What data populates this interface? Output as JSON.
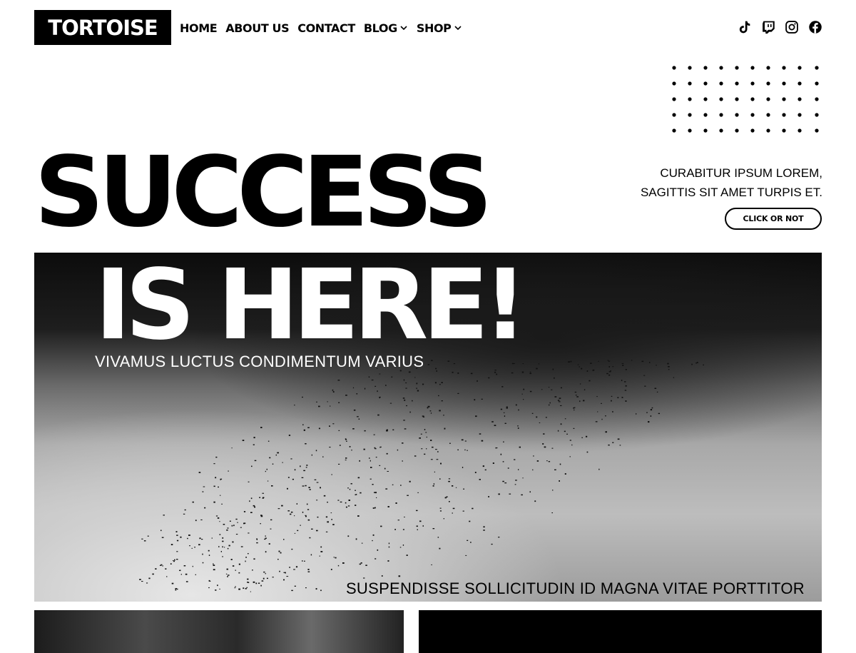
{
  "header": {
    "logo": "TORTOISE",
    "nav": [
      {
        "label": "HOME",
        "has_dropdown": false
      },
      {
        "label": "ABOUT US",
        "has_dropdown": false
      },
      {
        "label": "CONTACT",
        "has_dropdown": false
      },
      {
        "label": "BLOG",
        "has_dropdown": true
      },
      {
        "label": "SHOP",
        "has_dropdown": true
      }
    ],
    "social_icons": [
      "tiktok-icon",
      "twitch-icon",
      "instagram-icon",
      "facebook-icon"
    ]
  },
  "hero": {
    "headline_line1": "SUCCESS",
    "headline_line2": "IS HERE!",
    "subtitle": "VIVAMUS LUCTUS CONDIMENTUM VARIUS",
    "caption": "SUSPENDISSE SOLLICITUDIN ID MAGNA VITAE PORTTITOR"
  },
  "aside": {
    "line1": "CURABITUR IPSUM LOREM,",
    "line2": "SAGITTIS SIT AMET TURPIS ET.",
    "button_label": "CLICK OR NOT"
  },
  "colors": {
    "primary": "#000000",
    "background": "#ffffff"
  }
}
